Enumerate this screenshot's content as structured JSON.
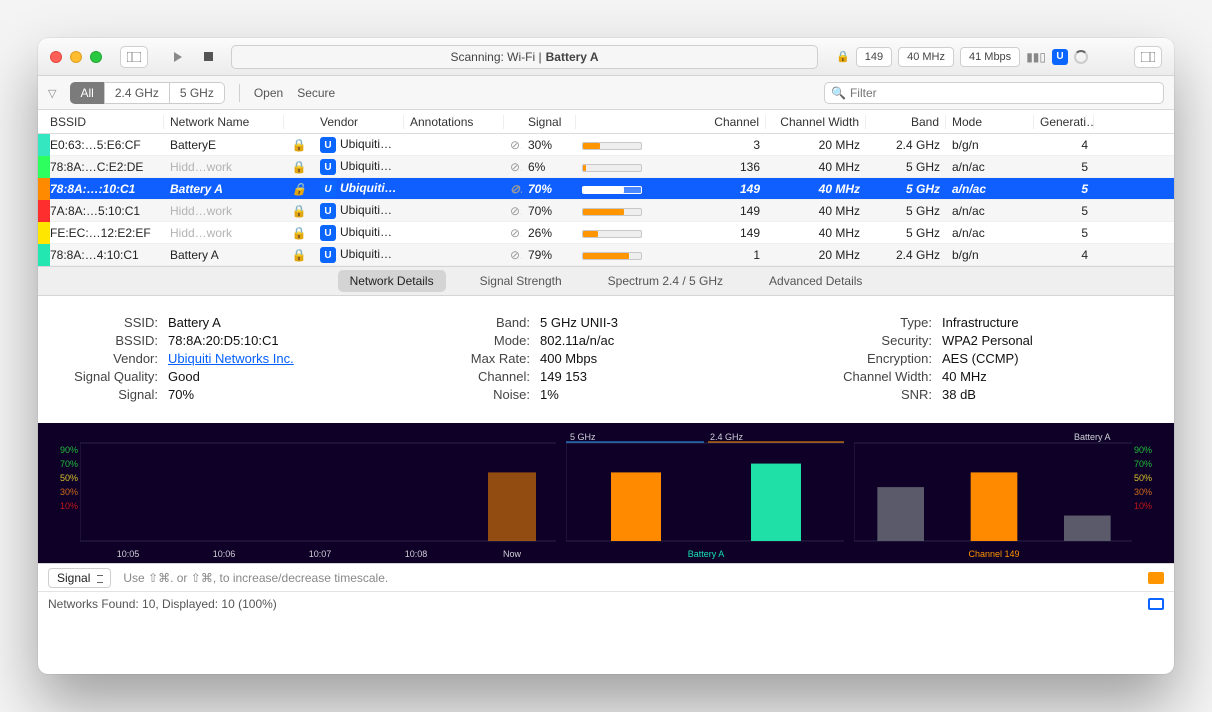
{
  "titlebar": {
    "scanning_prefix": "Scanning: Wi-Fi  |  ",
    "network": "Battery A",
    "channel": "149",
    "width": "40 MHz",
    "rate": "41 Mbps"
  },
  "filterbar": {
    "all": "All",
    "band24": "2.4 GHz",
    "band5": "5 GHz",
    "open": "Open",
    "secure": "Secure",
    "search_placeholder": "Filter"
  },
  "columns": {
    "bssid": "BSSID",
    "name": "Network Name",
    "vendor": "Vendor",
    "annotations": "Annotations",
    "signal": "Signal",
    "channel": "Channel",
    "width": "Channel Width",
    "band": "Band",
    "mode": "Mode",
    "gen": "Generati…"
  },
  "rows": [
    {
      "color": "#34e7c0",
      "bssid": "E0:63:…5:E6:CF",
      "name": "BatteryE",
      "hidden": false,
      "vendor": "Ubiquiti…",
      "signal": "30%",
      "sig": 30,
      "channel": "3",
      "width": "20 MHz",
      "band": "2.4 GHz",
      "mode": "b/g/n",
      "gen": "4"
    },
    {
      "color": "#2dff5e",
      "bssid": "78:8A:…C:E2:DE",
      "name": "Hidd…work",
      "hidden": true,
      "vendor": "Ubiquiti…",
      "signal": "6%",
      "sig": 6,
      "channel": "136",
      "width": "40 MHz",
      "band": "5 GHz",
      "mode": "a/n/ac",
      "gen": "5"
    },
    {
      "color": "#ff8a00",
      "bssid": "78:8A:…:10:C1",
      "name": "Battery A",
      "hidden": false,
      "vendor": "Ubiquiti…",
      "signal": "70%",
      "sig": 70,
      "channel": "149",
      "width": "40 MHz",
      "band": "5 GHz",
      "mode": "a/n/ac",
      "gen": "5",
      "selected": true
    },
    {
      "color": "#ff2e2e",
      "bssid": "7A:8A:…5:10:C1",
      "name": "Hidd…work",
      "hidden": true,
      "vendor": "Ubiquiti…",
      "signal": "70%",
      "sig": 70,
      "channel": "149",
      "width": "40 MHz",
      "band": "5 GHz",
      "mode": "a/n/ac",
      "gen": "5"
    },
    {
      "color": "#ffe600",
      "bssid": "FE:EC:…12:E2:EF",
      "name": "Hidd…work",
      "hidden": true,
      "vendor": "Ubiquiti…",
      "signal": "26%",
      "sig": 26,
      "channel": "149",
      "width": "40 MHz",
      "band": "5 GHz",
      "mode": "a/n/ac",
      "gen": "5"
    },
    {
      "color": "#23e7b1",
      "bssid": "78:8A:…4:10:C1",
      "name": "Battery A",
      "hidden": false,
      "vendor": "Ubiquiti…",
      "signal": "79%",
      "sig": 79,
      "channel": "1",
      "width": "20 MHz",
      "band": "2.4 GHz",
      "mode": "b/g/n",
      "gen": "4"
    }
  ],
  "detail_tabs": {
    "network": "Network Details",
    "signal": "Signal Strength",
    "spectrum": "Spectrum 2.4 / 5 GHz",
    "advanced": "Advanced Details"
  },
  "details": {
    "left": {
      "ssid_l": "SSID:",
      "ssid": "Battery A",
      "bssid_l": "BSSID:",
      "bssid": "78:8A:20:D5:10:C1",
      "vendor_l": "Vendor:",
      "vendor": "Ubiquiti Networks Inc.",
      "sq_l": "Signal Quality:",
      "sq": "Good",
      "sig_l": "Signal:",
      "sig": "70%"
    },
    "mid": {
      "band_l": "Band:",
      "band": "5 GHz UNII-3",
      "mode_l": "Mode:",
      "mode": "802.11a/n/ac",
      "rate_l": "Max Rate:",
      "rate": "400 Mbps",
      "chan_l": "Channel:",
      "chan": "149 153",
      "noise_l": "Noise:",
      "noise": "1%"
    },
    "right": {
      "type_l": "Type:",
      "type": "Infrastructure",
      "sec_l": "Security:",
      "sec": "WPA2 Personal",
      "enc_l": "Encryption:",
      "enc": "AES (CCMP)",
      "cw_l": "Channel Width:",
      "cw": "40 MHz",
      "snr_l": "SNR:",
      "snr": "38 dB"
    }
  },
  "chart_data": [
    {
      "type": "bar",
      "title": "",
      "x": [
        "10:05",
        "10:06",
        "10:07",
        "10:08",
        "Now"
      ],
      "series": [
        {
          "name": "Battery A",
          "values": [
            null,
            null,
            null,
            null,
            70
          ]
        }
      ],
      "ylim": [
        0,
        100
      ],
      "ylabels": [
        "90%",
        "70%",
        "50%",
        "30%",
        "10%"
      ]
    },
    {
      "type": "bar",
      "title_left": "5 GHz",
      "title_right": "2.4 GHz",
      "categories": [
        "5 GHz",
        "2.4 GHz"
      ],
      "values": [
        70,
        79
      ],
      "colors": [
        "#ff8a00",
        "#1fe0a7"
      ],
      "xlabel": "Battery A",
      "ylim": [
        0,
        100
      ]
    },
    {
      "type": "bar",
      "title": "Battery A",
      "categories": [
        "other-1",
        "selected",
        "other-2"
      ],
      "values": [
        55,
        70,
        26
      ],
      "colors": [
        "#5a5a6a",
        "#ff8a00",
        "#5a5a6a"
      ],
      "xlabel": "Channel 149",
      "ylim": [
        0,
        100
      ]
    }
  ],
  "chart_ylabels": [
    "90%",
    "70%",
    "50%",
    "30%",
    "10%"
  ],
  "footer": {
    "select": "Signal",
    "hint": "Use ⇧⌘. or ⇧⌘, to increase/decrease timescale.",
    "status": "Networks Found: 10, Displayed: 10 (100%)"
  }
}
